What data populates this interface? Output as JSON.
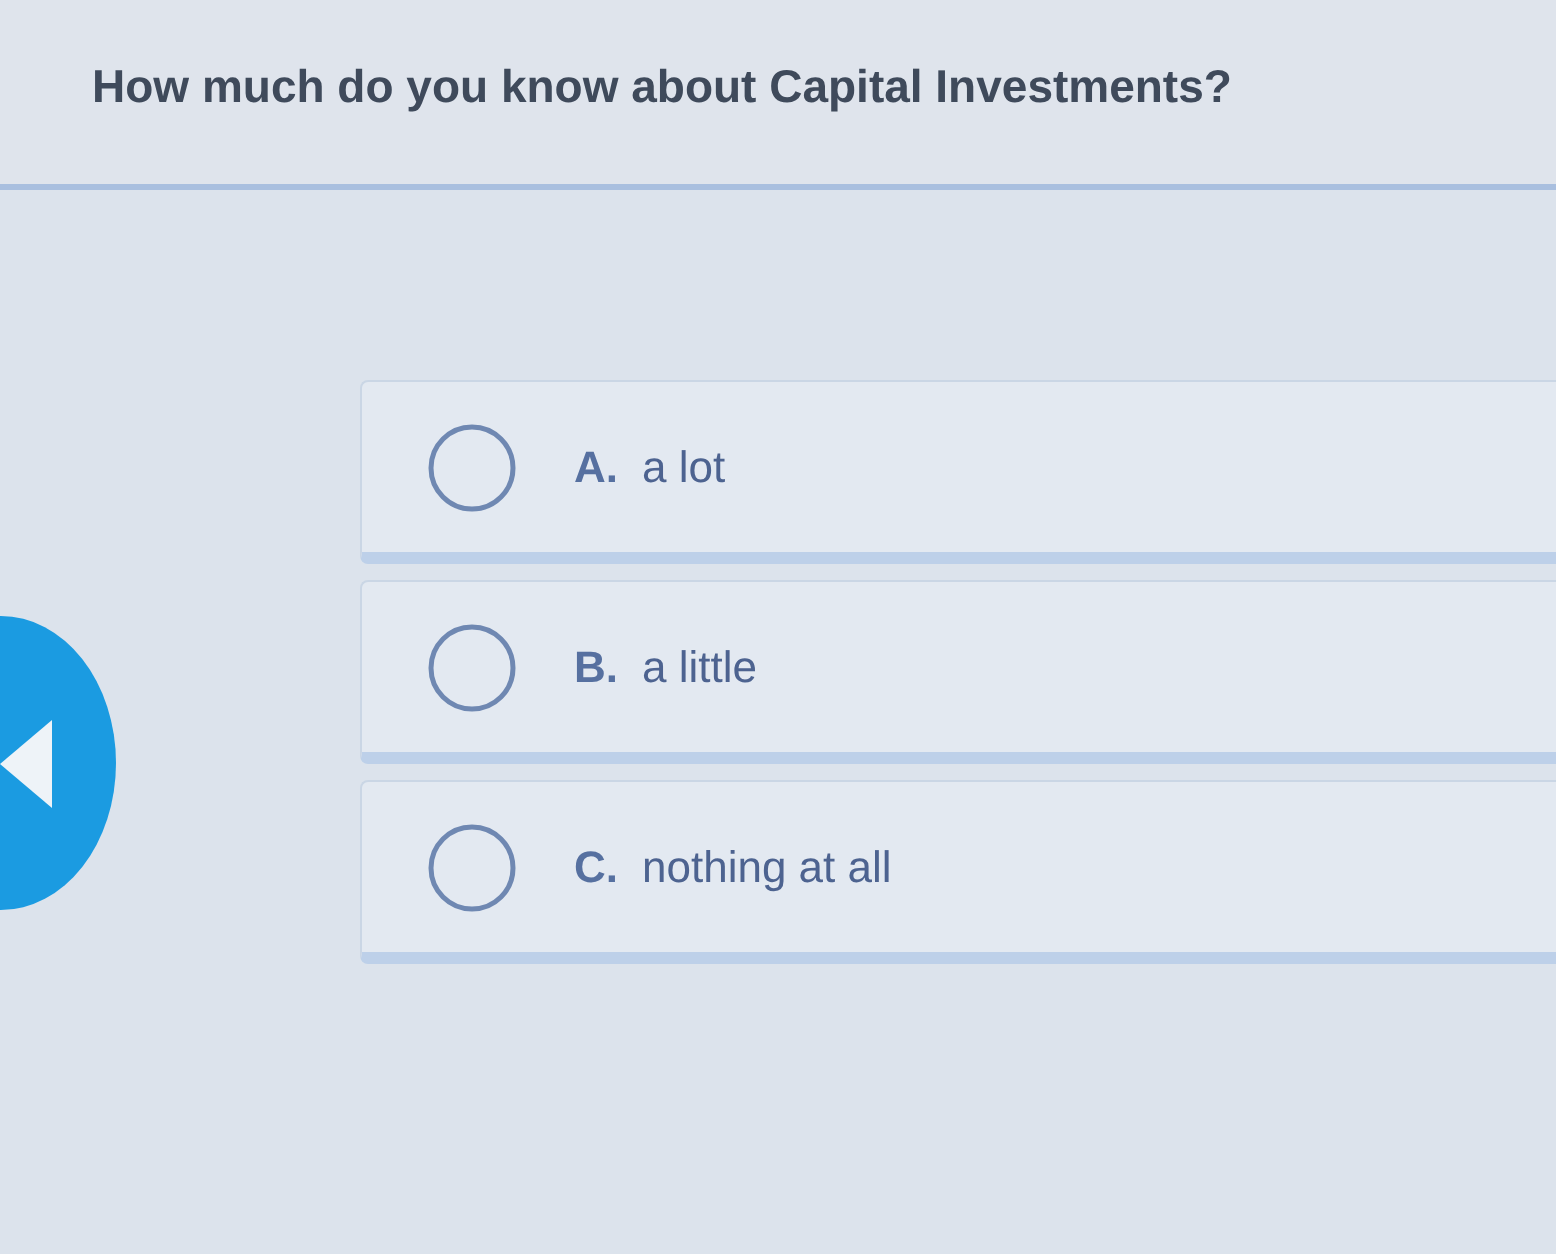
{
  "question": "How much do you know about Capital Investments?",
  "options": [
    {
      "letter": "A.",
      "text": "a lot",
      "selected": false
    },
    {
      "letter": "B.",
      "text": "a little",
      "selected": false
    },
    {
      "letter": "C.",
      "text": "nothing at all",
      "selected": false
    }
  ]
}
